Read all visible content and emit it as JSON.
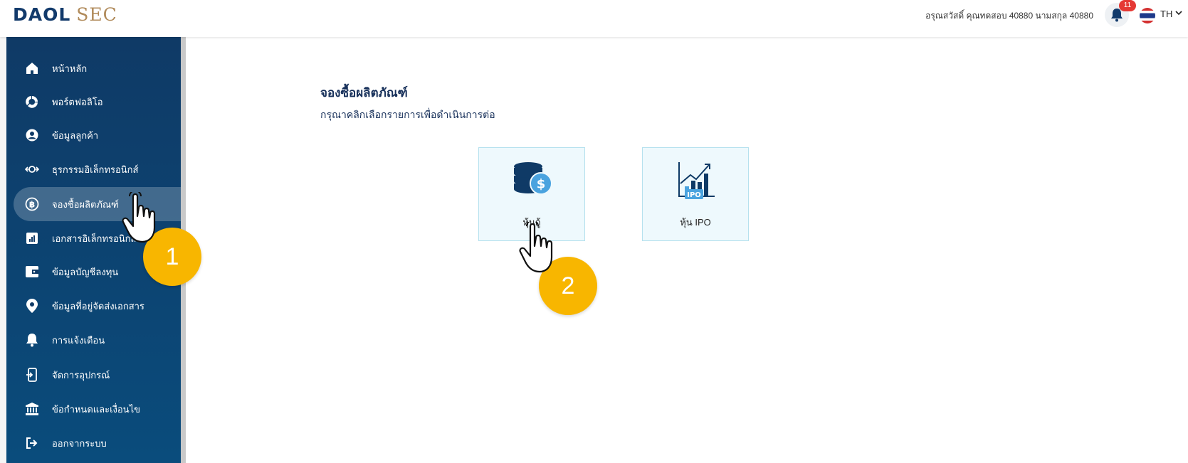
{
  "header": {
    "logo_primary": "DAOL",
    "logo_secondary": "SEC",
    "greeting": "อรุณสวัสดิ์ คุณทดสอบ 40880 นามสกุล 40880",
    "notification_count": "11",
    "language": "TH"
  },
  "sidebar": {
    "items": [
      {
        "label": "หน้าหลัก",
        "icon": "home-icon"
      },
      {
        "label": "พอร์ตฟอลิโอ",
        "icon": "portfolio-icon"
      },
      {
        "label": "ข้อมูลลูกค้า",
        "icon": "user-circle-icon"
      },
      {
        "label": "ธุรกรรมอิเล็กทรอนิกส์",
        "icon": "transfer-icon"
      },
      {
        "label": "จองซื้อผลิตภัณฑ์",
        "icon": "baht-coin-icon",
        "active": true
      },
      {
        "label": "เอกสารอิเล็กทรอนิกส์",
        "icon": "report-icon"
      },
      {
        "label": "ข้อมูลบัญชีลงทุน",
        "icon": "wallet-icon"
      },
      {
        "label": "ข้อมูลที่อยู่จัดส่งเอกสาร",
        "icon": "location-pin-icon"
      },
      {
        "label": "การแจ้งเตือน",
        "icon": "bell-icon"
      },
      {
        "label": "จัดการอุปกรณ์",
        "icon": "device-icon"
      },
      {
        "label": "ข้อกำหนดและเงื่อนไข",
        "icon": "bank-icon"
      },
      {
        "label": "ออกจากระบบ",
        "icon": "logout-icon"
      }
    ]
  },
  "main": {
    "title": "จองซื้อผลิตภัณฑ์",
    "subtitle": "กรุณาคลิกเลือกรายการเพื่อดำเนินการต่อ",
    "cards": [
      {
        "label": "หุ้นกู้",
        "icon": "coins-dollar-icon"
      },
      {
        "label": "หุ้น IPO",
        "icon": "ipo-chart-icon"
      }
    ]
  },
  "tutorial": {
    "step1": "1",
    "step2": "2"
  },
  "colors": {
    "sidebar_top": "#0f3a66",
    "sidebar_bottom": "#0a4c7c",
    "accent_gold": "#f8b600",
    "card_bg": "#eef9fd"
  }
}
